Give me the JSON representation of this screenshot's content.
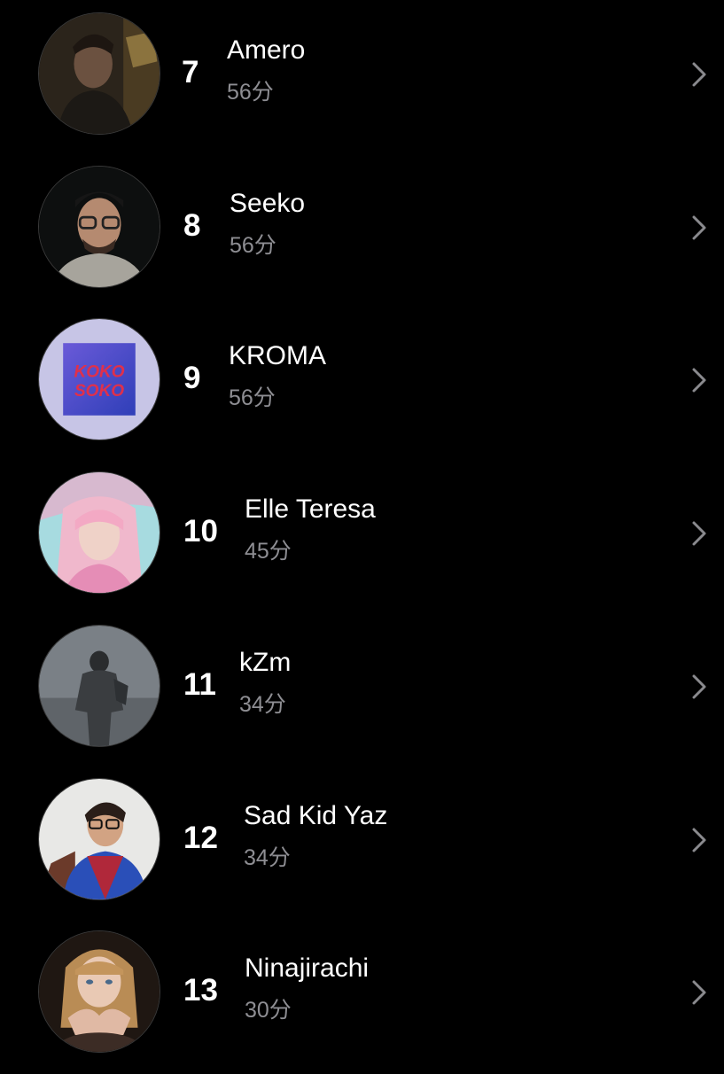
{
  "artists": [
    {
      "rank": "7",
      "name": "Amero",
      "duration": "56分"
    },
    {
      "rank": "8",
      "name": "Seeko",
      "duration": "56分"
    },
    {
      "rank": "9",
      "name": "KROMA",
      "duration": "56分",
      "cover_text": [
        "KOKO",
        "SOKO"
      ]
    },
    {
      "rank": "10",
      "name": "Elle Teresa",
      "duration": "45分"
    },
    {
      "rank": "11",
      "name": "kZm",
      "duration": "34分"
    },
    {
      "rank": "12",
      "name": "Sad Kid Yaz",
      "duration": "34分"
    },
    {
      "rank": "13",
      "name": "Ninajirachi",
      "duration": "30分"
    }
  ],
  "colors": {
    "background": "#000000",
    "text": "#ffffff",
    "secondary": "#8e8e93",
    "chevron": "#8a8a8e"
  }
}
